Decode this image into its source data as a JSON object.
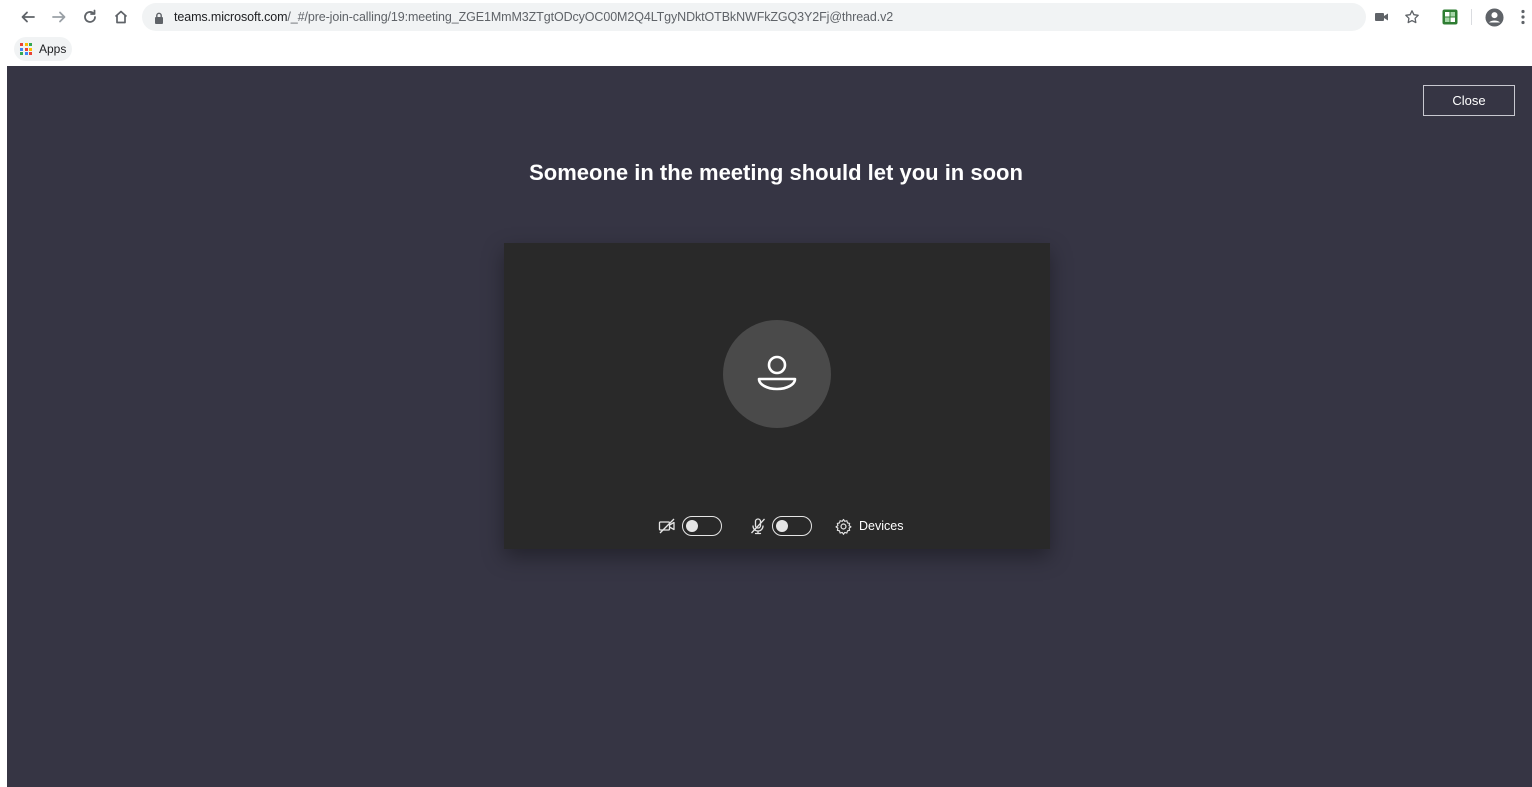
{
  "browser": {
    "url_host": "teams.microsoft.com",
    "url_path": "/_#/pre-join-calling/19:meeting_ZGE1MmM3ZTgtODcyOC00M2Q4LTgyNDktOTBkNWFkZGQ3Y2Fj@thread.v2",
    "bookmarks": {
      "apps_label": "Apps"
    }
  },
  "meeting": {
    "close_label": "Close",
    "heading": "Someone in the meeting should let you in soon",
    "devices_label": "Devices",
    "camera_on": false,
    "mic_on": false
  },
  "colors": {
    "app_background": "#363544",
    "preview_background": "#292929",
    "avatar_background": "#4a4a4a"
  }
}
